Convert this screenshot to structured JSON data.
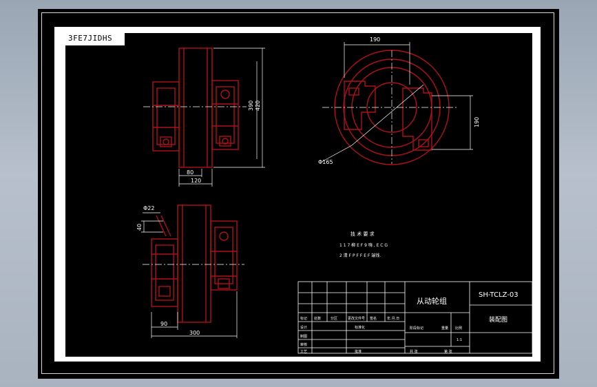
{
  "sheet": {
    "title_tab": "3FE7JIDHS"
  },
  "colors": {
    "part_line": "#b0101a",
    "dimension_line": "#ffffff",
    "background": "#000000",
    "sheet_border": "#ffffff",
    "window_background": "#a9b3bf"
  },
  "views": {
    "front_view_dims": [
      "390",
      "420",
      "80",
      "120"
    ],
    "side_view_dims": [
      "190",
      "190",
      "Φ165"
    ],
    "bottom_view_dims": [
      "Φ22",
      "40",
      "90",
      "300"
    ]
  },
  "technical_notes": {
    "heading": "技 术 要 求",
    "line1": "1 1 7 柳 E F 9 嗨 , E C G",
    "line2": "2 清 F P F F E F 端钱."
  },
  "title_block": {
    "part_name": "从动轮组",
    "drawing_number": "SH-TCLZ-03",
    "drawing_type": "装配图",
    "row_labels": [
      "标记",
      "处数",
      "分区",
      "更改文件号",
      "签名",
      "年.月.日"
    ],
    "left_labels": [
      "设计",
      "制图",
      "审核",
      "工艺"
    ],
    "mid_labels": [
      "标准化",
      "批准"
    ],
    "stage_label": "阶段标记",
    "weight_label": "重量",
    "scale_label": "比例",
    "scale_value": "1:1",
    "sheet_label": "共 张",
    "page_label": "第 张"
  }
}
